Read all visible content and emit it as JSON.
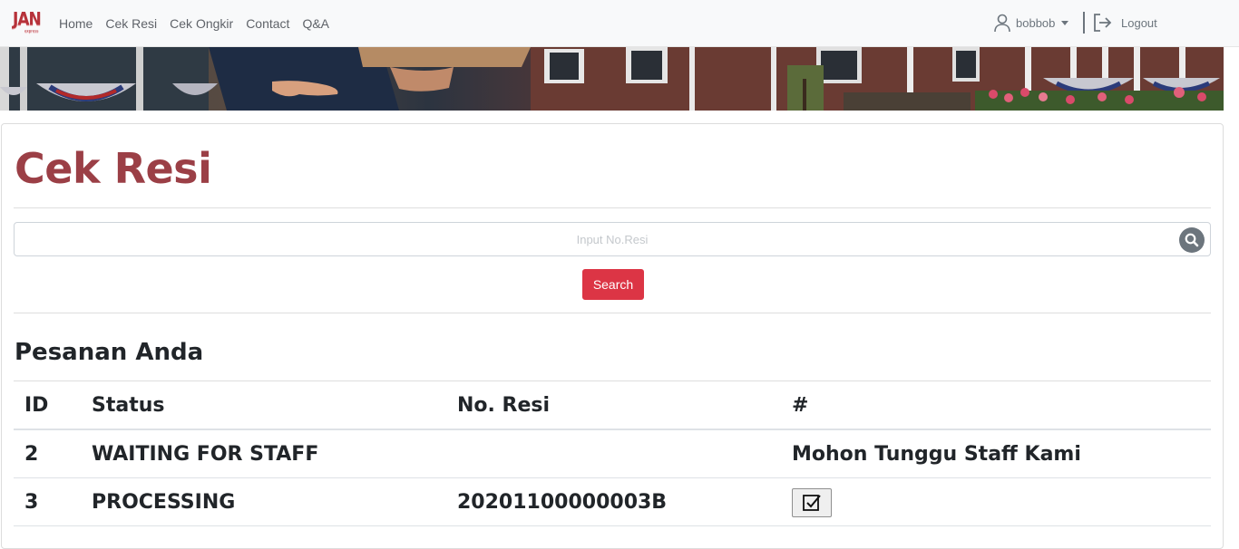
{
  "brand": {
    "logo_text": "JAN",
    "logo_sub": "express"
  },
  "nav": {
    "links": [
      {
        "label": "Home"
      },
      {
        "label": "Cek Resi"
      },
      {
        "label": "Cek Ongkir"
      },
      {
        "label": "Contact"
      },
      {
        "label": "Q&A"
      }
    ],
    "user": {
      "name": "bobbob",
      "icon": "user-icon"
    },
    "logout": {
      "label": "Logout",
      "icon": "logout-icon"
    }
  },
  "page": {
    "title": "Cek Resi",
    "search": {
      "placeholder": "Input No.Resi",
      "value": "",
      "icon": "search-icon",
      "button_label": "Search"
    }
  },
  "orders": {
    "title": "Pesanan Anda",
    "columns": [
      "ID",
      "Status",
      "No. Resi",
      "#"
    ],
    "rows": [
      {
        "id": "2",
        "status": "WAITING FOR STAFF",
        "resi": "",
        "action_text": "Mohon Tunggu Staff Kami"
      },
      {
        "id": "3",
        "status": "PROCESSING",
        "resi": "20201100000003B",
        "action_icon": "check-square-icon"
      }
    ]
  },
  "colors": {
    "title": "#9b3f46",
    "brand": "#b6323a",
    "search_button": "#dc3545",
    "navbar_bg": "#f8f9fa"
  }
}
